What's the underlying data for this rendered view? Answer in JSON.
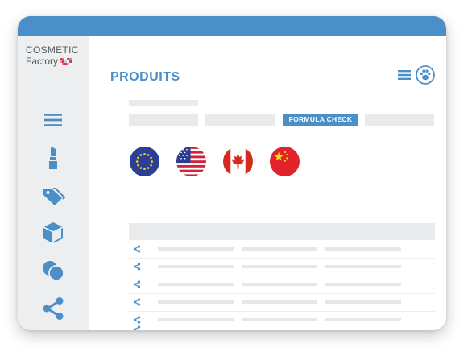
{
  "brand": {
    "line1": "COSMETIC",
    "line2": "Factory"
  },
  "page": {
    "title": "PRODUITS"
  },
  "tabs": {
    "active_label": "FORMULA CHECK"
  },
  "sidebar": {
    "icons": [
      "menu-icon",
      "lipstick-icon",
      "tags-icon",
      "box-icon",
      "circles-icon",
      "share-icon"
    ]
  },
  "flags": [
    "eu-flag-icon",
    "us-flag-icon",
    "canada-flag-icon",
    "china-flag-icon"
  ],
  "colors": {
    "accent": "#4a8fc7",
    "sidebar_bg": "#eceeef",
    "skeleton": "#e9eaeb"
  }
}
